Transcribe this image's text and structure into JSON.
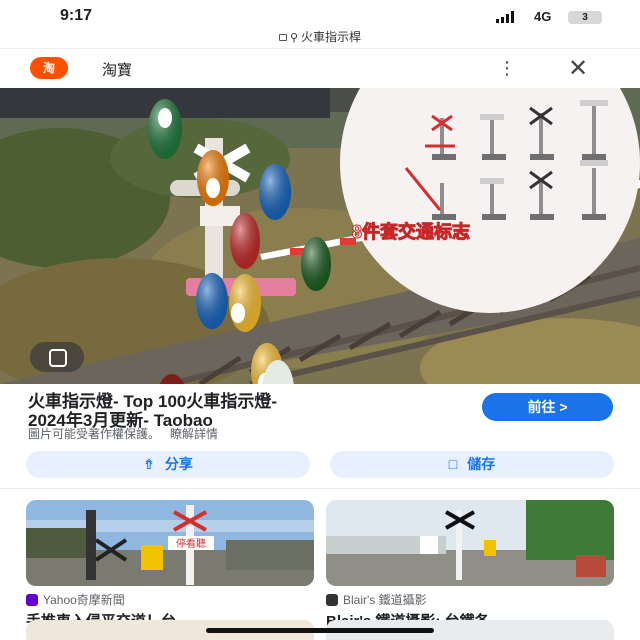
{
  "status": {
    "time": "9:17",
    "network": "4G",
    "battery": "3"
  },
  "url": {
    "text": "火車指示桿"
  },
  "site": {
    "name": "淘寶"
  },
  "hero": {
    "overlay_text": "8件套交通标志"
  },
  "result": {
    "title_line1": "火車指示燈- Top 100火車指示燈-",
    "title_line2": "2024年3月更新- Taobao",
    "goto_label": "前往 >",
    "copyright": "圖片可能受著作權保護。",
    "learn_more": "瞭解詳情"
  },
  "actions": {
    "share_label": "分享",
    "save_label": "儲存"
  },
  "cards": [
    {
      "source": "Yahoo奇摩新聞",
      "title": "手推車入侵平交道！台...",
      "thumb_text": "停看聽"
    },
    {
      "source": "Blair's 鐵道攝影",
      "title": "Blair's 鐵道攝影: 台鐵各..."
    }
  ],
  "colors": {
    "accent": "#1a73e8",
    "accent_bg": "#e8f0fe",
    "brand": "#ff5000"
  }
}
